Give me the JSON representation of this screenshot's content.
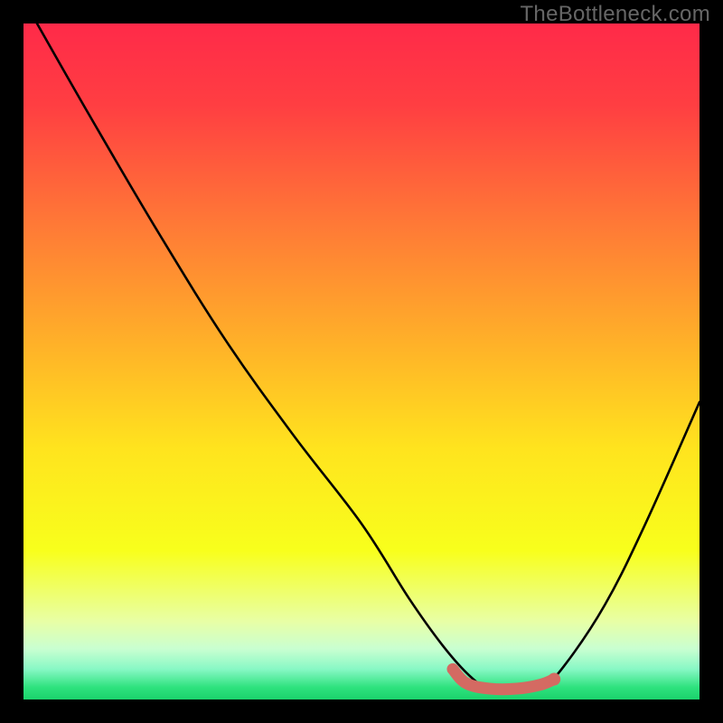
{
  "watermark": "TheBottleneck.com",
  "chart_data": {
    "type": "line",
    "title": "",
    "xlabel": "",
    "ylabel": "",
    "xlim": [
      0,
      100
    ],
    "ylim": [
      0,
      100
    ],
    "grid": false,
    "legend": false,
    "gradient_stops": [
      {
        "offset": 0.0,
        "color": "#ff2a49"
      },
      {
        "offset": 0.12,
        "color": "#ff3e42"
      },
      {
        "offset": 0.3,
        "color": "#ff7a36"
      },
      {
        "offset": 0.48,
        "color": "#ffb328"
      },
      {
        "offset": 0.63,
        "color": "#ffe41e"
      },
      {
        "offset": 0.78,
        "color": "#f8ff1c"
      },
      {
        "offset": 0.885,
        "color": "#e8ffa6"
      },
      {
        "offset": 0.925,
        "color": "#c9ffd1"
      },
      {
        "offset": 0.955,
        "color": "#88f8c5"
      },
      {
        "offset": 0.982,
        "color": "#2ee27e"
      },
      {
        "offset": 1.0,
        "color": "#1bd26c"
      }
    ],
    "curve": {
      "description": "Bottleneck percentage curve plunging from top-left to a trough around x≈70‑76, then rising to the right",
      "points": [
        {
          "x": 2,
          "y": 100
        },
        {
          "x": 10,
          "y": 86
        },
        {
          "x": 20,
          "y": 69
        },
        {
          "x": 30,
          "y": 53
        },
        {
          "x": 40,
          "y": 39
        },
        {
          "x": 50,
          "y": 26
        },
        {
          "x": 57,
          "y": 15
        },
        {
          "x": 62,
          "y": 8
        },
        {
          "x": 66,
          "y": 3.5
        },
        {
          "x": 69,
          "y": 1.5
        },
        {
          "x": 73,
          "y": 1.2
        },
        {
          "x": 77,
          "y": 2.2
        },
        {
          "x": 80,
          "y": 5
        },
        {
          "x": 86,
          "y": 14
        },
        {
          "x": 92,
          "y": 26
        },
        {
          "x": 100,
          "y": 44
        }
      ]
    },
    "highlight_band": {
      "description": "Salmon rounded stroke marking the optimal (near-zero bottleneck) region",
      "x_start": 63.5,
      "x_end": 78.5,
      "y": 1.6,
      "dot_x": 78.5,
      "dot_y": 3.0,
      "color": "#d46a62"
    }
  }
}
